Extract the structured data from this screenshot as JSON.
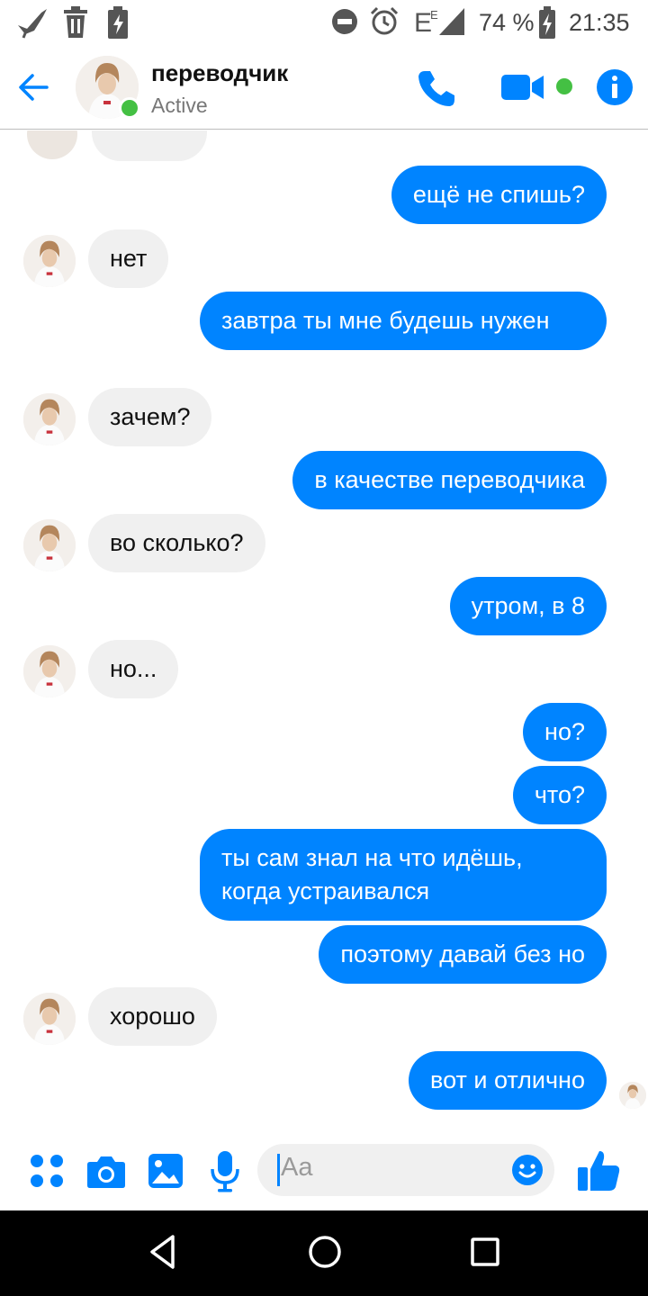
{
  "status_bar": {
    "icons": [
      "bird-notification-icon",
      "trash-icon",
      "battery-saver-icon",
      "do-not-disturb-icon",
      "alarm-icon",
      "signal-e-icon"
    ],
    "battery": "74 %",
    "time": "21:35"
  },
  "header": {
    "back_icon": "arrow-left-icon",
    "contact_name": "переводчик",
    "contact_status": "Active",
    "actions": [
      "phone-icon",
      "video-camera-icon",
      "info-icon"
    ],
    "accent_color": "#0084ff",
    "online_color": "#44c043"
  },
  "messages": [
    {
      "from": "me",
      "text": "ещё не спишь?"
    },
    {
      "from": "contact",
      "text": "нет"
    },
    {
      "from": "me",
      "text": "завтра ты мне будешь нужен"
    },
    {
      "from": "contact",
      "text": "зачем?"
    },
    {
      "from": "me",
      "text": "в качестве переводчика"
    },
    {
      "from": "contact",
      "text": "во сколько?"
    },
    {
      "from": "me",
      "text": "утром, в 8"
    },
    {
      "from": "contact",
      "text": "но..."
    },
    {
      "from": "me",
      "text": "но?"
    },
    {
      "from": "me",
      "text": "что?"
    },
    {
      "from": "me",
      "text": "ты сам знал на что идёшь, когда устраивался"
    },
    {
      "from": "me",
      "text": "поэтому давай без но"
    },
    {
      "from": "contact",
      "text": "хорошо"
    },
    {
      "from": "me",
      "text": "вот и отлично"
    }
  ],
  "composer": {
    "buttons": [
      "more-apps-icon",
      "camera-icon",
      "gallery-icon",
      "microphone-icon"
    ],
    "placeholder": "Aa",
    "emoji_icon": "smiley-icon",
    "send_icon": "thumbs-up-icon"
  },
  "nav_bar": {
    "buttons": [
      "back-triangle-icon",
      "home-circle-icon",
      "recents-square-icon"
    ]
  }
}
